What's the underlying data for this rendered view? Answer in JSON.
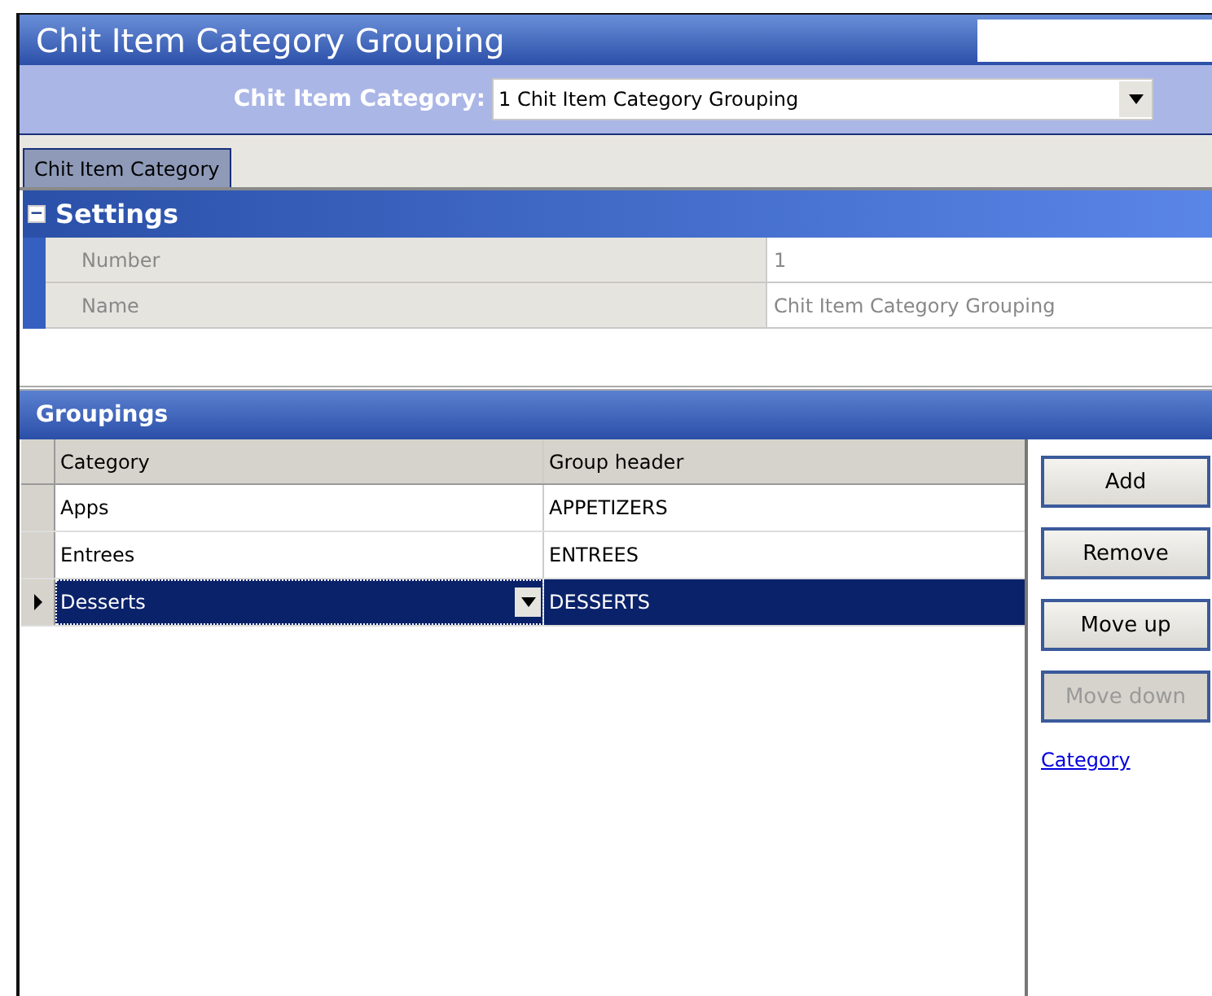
{
  "window": {
    "title": "Chit Item Category Grouping"
  },
  "filter": {
    "label": "Chit Item Category:",
    "value": "1 Chit Item Category Grouping"
  },
  "tabs": [
    {
      "label": "Chit Item Category",
      "selected": true
    }
  ],
  "settings": {
    "title": "Settings",
    "expanded": true,
    "collapse_glyph": "−",
    "rows": [
      {
        "label": "Number",
        "value": "1"
      },
      {
        "label": "Name",
        "value": "Chit Item Category Grouping"
      }
    ]
  },
  "groupings": {
    "title": "Groupings",
    "columns": [
      "Category",
      "Group header"
    ],
    "rows": [
      {
        "category": "Apps",
        "group_header": "APPETIZERS",
        "selected": false
      },
      {
        "category": "Entrees",
        "group_header": "ENTREES",
        "selected": false
      },
      {
        "category": "Desserts",
        "group_header": "DESSERTS",
        "selected": true
      }
    ]
  },
  "buttons": [
    {
      "label": "Add",
      "disabled": false
    },
    {
      "label": "Remove",
      "disabled": false
    },
    {
      "label": "Move up",
      "disabled": false
    },
    {
      "label": "Move down",
      "disabled": true
    }
  ],
  "link": "Category"
}
